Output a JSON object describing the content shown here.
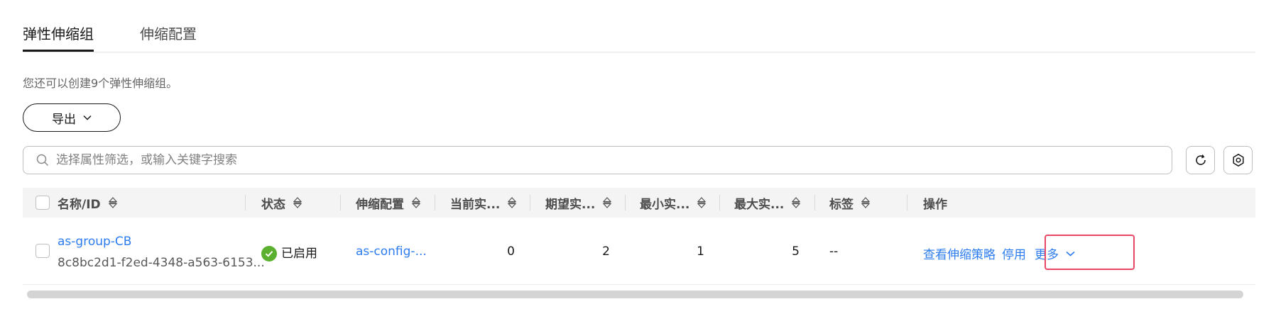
{
  "tabs": {
    "active": "弹性伸缩组",
    "config": "伸缩配置"
  },
  "tip": "您还可以创建9个弹性伸缩组。",
  "toolbar": {
    "export_label": "导出"
  },
  "search": {
    "placeholder": "选择属性筛选，或输入关键字搜索"
  },
  "table": {
    "headers": {
      "name": "名称/ID",
      "status": "状态",
      "config": "伸缩配置",
      "current": "当前实...",
      "desired": "期望实...",
      "min": "最小实...",
      "max": "最大实...",
      "tags": "标签",
      "actions": "操作"
    },
    "rows": [
      {
        "name": "as-group-CB",
        "id": "8c8bc2d1-f2ed-4348-a563-6153...",
        "status": "已启用",
        "config": "as-config-...",
        "current": "0",
        "desired": "2",
        "min": "1",
        "max": "5",
        "tags": "--",
        "action_view_policy": "查看伸缩策略",
        "action_disable": "停用",
        "action_more": "更多"
      }
    ]
  },
  "colors": {
    "link": "#2d7cef",
    "status_ok": "#5bb02f",
    "highlight": "#e84865",
    "header_bg": "#f4f4f4"
  }
}
